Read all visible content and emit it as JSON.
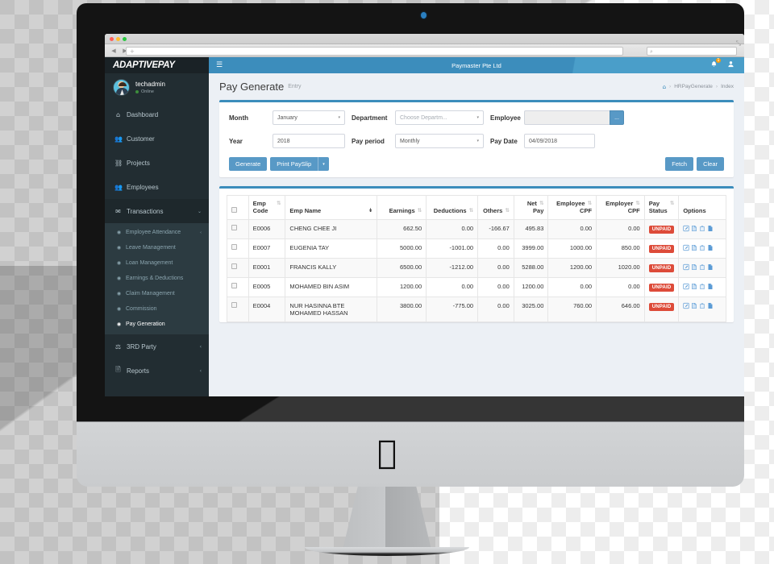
{
  "browser": {
    "url_value": "",
    "url_placeholder": "",
    "search_placeholder": "",
    "back_icon": "◀",
    "forward_icon": "▶",
    "plus_icon": "+",
    "search_icon": "⌕",
    "expand_icon": "⤡"
  },
  "sidebar": {
    "brand": "ADAPTIVEPAY",
    "user": {
      "name": "techadmin",
      "status": "Online"
    },
    "items": [
      {
        "label": "Dashboard",
        "icon": "⌂",
        "caret": ""
      },
      {
        "label": "Customer",
        "icon": "👥",
        "caret": ""
      },
      {
        "label": "Projects",
        "icon": "⛓",
        "caret": ""
      },
      {
        "label": "Employees",
        "icon": "👥",
        "caret": ""
      },
      {
        "label": "Transactions",
        "icon": "✉",
        "caret": "⌄"
      }
    ],
    "subitems": [
      {
        "label": "Employee Attendance",
        "icon": "◉",
        "caret": "‹",
        "active": false
      },
      {
        "label": "Leave Management",
        "icon": "◉",
        "caret": "",
        "active": false
      },
      {
        "label": "Loan Management",
        "icon": "◉",
        "caret": "",
        "active": false
      },
      {
        "label": "Earnings & Deductions",
        "icon": "◉",
        "caret": "",
        "active": false
      },
      {
        "label": "Claim Management",
        "icon": "◉",
        "caret": "",
        "active": false
      },
      {
        "label": "Commission",
        "icon": "◉",
        "caret": "",
        "active": false
      },
      {
        "label": "Pay Generation",
        "icon": "◉",
        "caret": "",
        "active": true
      }
    ],
    "items_bottom": [
      {
        "label": "3RD Party",
        "icon": "⚖",
        "caret": "‹"
      },
      {
        "label": "Reports",
        "icon": "🗎",
        "caret": "‹"
      }
    ]
  },
  "topbar": {
    "hamburger_icon": "☰",
    "company": "Paymaster Pte Ltd",
    "bell_icon": "🔔",
    "notif_count": "1",
    "user_icon": "👤"
  },
  "page": {
    "title": "Pay Generate",
    "subtitle": "Entry",
    "breadcrumb": {
      "home_icon": "⌂",
      "sep": "›",
      "items": [
        "HRPayGenerate",
        "Index"
      ]
    }
  },
  "form": {
    "month_label": "Month",
    "month_value": "January",
    "department_label": "Department",
    "department_value": "Choose Departm...",
    "employee_label": "Employee",
    "employee_value": "",
    "employee_btn": "...",
    "year_label": "Year",
    "year_value": "2018",
    "payperiod_label": "Pay period",
    "payperiod_value": "Monthly",
    "paydate_label": "Pay Date",
    "paydate_value": "04/09/2018",
    "caret_icon": "▾",
    "generate_label": "Generate",
    "print_label": "Print PaySlip",
    "print_caret": "▾",
    "fetch_label": "Fetch",
    "clear_label": "Clear"
  },
  "table": {
    "sort_icon": "⇅",
    "sort_icon_desc": "↡",
    "columns": [
      {
        "label": "",
        "sortable": false,
        "align": "left"
      },
      {
        "label": "Emp Code",
        "sortable": true,
        "align": "left"
      },
      {
        "label": "Emp Name",
        "sortable": true,
        "active": true,
        "align": "left"
      },
      {
        "label": "Earnings",
        "sortable": true,
        "align": "right"
      },
      {
        "label": "Deductions",
        "sortable": true,
        "align": "right"
      },
      {
        "label": "Others",
        "sortable": true,
        "align": "right"
      },
      {
        "label": "Net Pay",
        "sortable": true,
        "align": "right"
      },
      {
        "label": "Employee CPF",
        "sortable": true,
        "align": "right"
      },
      {
        "label": "Employer CPF",
        "sortable": true,
        "align": "right"
      },
      {
        "label": "Pay Status",
        "sortable": true,
        "align": "left"
      },
      {
        "label": "Options",
        "sortable": false,
        "align": "left"
      }
    ],
    "rows": [
      {
        "code": "E0006",
        "name": "CHENG CHEE JI",
        "earnings": "662.50",
        "deductions": "0.00",
        "others": "-166.67",
        "net": "495.83",
        "emp_cpf": "0.00",
        "empr_cpf": "0.00",
        "status": "UNPAID"
      },
      {
        "code": "E0007",
        "name": "EUGENIA TAY",
        "earnings": "5000.00",
        "deductions": "-1001.00",
        "others": "0.00",
        "net": "3999.00",
        "emp_cpf": "1000.00",
        "empr_cpf": "850.00",
        "status": "UNPAID"
      },
      {
        "code": "E0001",
        "name": "FRANCIS KALLY",
        "earnings": "6500.00",
        "deductions": "-1212.00",
        "others": "0.00",
        "net": "5288.00",
        "emp_cpf": "1200.00",
        "empr_cpf": "1020.00",
        "status": "UNPAID"
      },
      {
        "code": "E0005",
        "name": "MOHAMED BIN ASIM",
        "earnings": "1200.00",
        "deductions": "0.00",
        "others": "0.00",
        "net": "1200.00",
        "emp_cpf": "0.00",
        "empr_cpf": "0.00",
        "status": "UNPAID"
      },
      {
        "code": "E0004",
        "name": "NUR HASINNA BTE MOHAMED HASSAN",
        "earnings": "3800.00",
        "deductions": "-775.00",
        "others": "0.00",
        "net": "3025.00",
        "emp_cpf": "760.00",
        "empr_cpf": "646.00",
        "status": "UNPAID"
      }
    ],
    "option_icons": [
      "edit-icon",
      "document-icon",
      "delete-icon",
      "payslip-icon"
    ]
  },
  "colors": {
    "accent": "#3c8dbc",
    "sidebar": "#222d32",
    "danger": "#dd4b39",
    "badge": "#f39c12"
  }
}
